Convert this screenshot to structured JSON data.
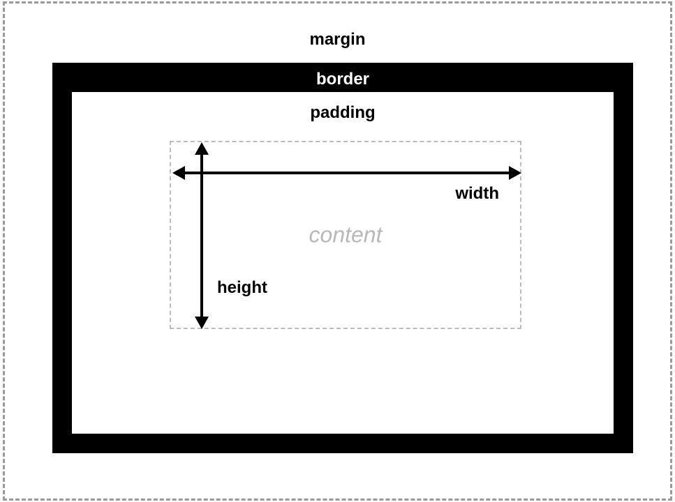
{
  "labels": {
    "margin": "margin",
    "border": "border",
    "padding": "padding",
    "content": "content",
    "width": "width",
    "height": "height"
  }
}
